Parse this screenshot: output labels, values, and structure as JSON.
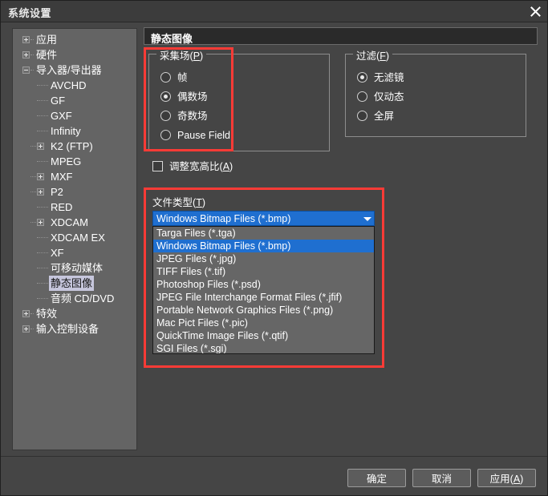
{
  "window": {
    "title": "系统设置",
    "close_icon": "close-icon"
  },
  "sidebar": {
    "items": [
      {
        "label": "应用",
        "depth": 0,
        "expander": "plus",
        "selected": false
      },
      {
        "label": "硬件",
        "depth": 0,
        "expander": "plus",
        "selected": false
      },
      {
        "label": "导入器/导出器",
        "depth": 0,
        "expander": "minus",
        "selected": false
      },
      {
        "label": "AVCHD",
        "depth": 1,
        "expander": "none",
        "selected": false
      },
      {
        "label": "GF",
        "depth": 1,
        "expander": "none",
        "selected": false
      },
      {
        "label": "GXF",
        "depth": 1,
        "expander": "none",
        "selected": false
      },
      {
        "label": "Infinity",
        "depth": 1,
        "expander": "none",
        "selected": false
      },
      {
        "label": "K2 (FTP)",
        "depth": 1,
        "expander": "plus",
        "selected": false
      },
      {
        "label": "MPEG",
        "depth": 1,
        "expander": "none",
        "selected": false
      },
      {
        "label": "MXF",
        "depth": 1,
        "expander": "plus",
        "selected": false
      },
      {
        "label": "P2",
        "depth": 1,
        "expander": "plus",
        "selected": false
      },
      {
        "label": "RED",
        "depth": 1,
        "expander": "none",
        "selected": false
      },
      {
        "label": "XDCAM",
        "depth": 1,
        "expander": "plus",
        "selected": false
      },
      {
        "label": "XDCAM EX",
        "depth": 1,
        "expander": "none",
        "selected": false
      },
      {
        "label": "XF",
        "depth": 1,
        "expander": "none",
        "selected": false
      },
      {
        "label": "可移动媒体",
        "depth": 1,
        "expander": "none",
        "selected": false
      },
      {
        "label": "静态图像",
        "depth": 1,
        "expander": "none",
        "selected": true
      },
      {
        "label": "音频 CD/DVD",
        "depth": 1,
        "expander": "none",
        "selected": false
      },
      {
        "label": "特效",
        "depth": 0,
        "expander": "plus",
        "selected": false
      },
      {
        "label": "输入控制设备",
        "depth": 0,
        "expander": "plus",
        "selected": false
      }
    ]
  },
  "content": {
    "header": "静态图像",
    "capture_field": {
      "title": "采集场",
      "accel": "P",
      "options": [
        {
          "label": "帧",
          "selected": false
        },
        {
          "label": "偶数场",
          "selected": true
        },
        {
          "label": "奇数场",
          "selected": false
        },
        {
          "label": "Pause Field",
          "selected": false
        }
      ]
    },
    "filter": {
      "title": "过滤",
      "accel": "F",
      "options": [
        {
          "label": "无滤镜",
          "selected": true
        },
        {
          "label": "仅动态",
          "selected": false
        },
        {
          "label": "全屏",
          "selected": false
        }
      ]
    },
    "aspect_checkbox": {
      "label": "调整宽高比",
      "accel": "A",
      "checked": false
    },
    "file_type": {
      "label": "文件类型",
      "accel": "T",
      "selected_value": "Windows Bitmap Files (*.bmp)",
      "dropdown_icon": "chevron-down-icon",
      "options": [
        {
          "label": "Targa Files (*.tga)",
          "selected": false
        },
        {
          "label": "Windows Bitmap Files (*.bmp)",
          "selected": true
        },
        {
          "label": "JPEG Files (*.jpg)",
          "selected": false
        },
        {
          "label": "TIFF Files (*.tif)",
          "selected": false
        },
        {
          "label": "Photoshop Files (*.psd)",
          "selected": false
        },
        {
          "label": "JPEG File Interchange Format Files (*.jfif)",
          "selected": false
        },
        {
          "label": "Portable Network Graphics Files (*.png)",
          "selected": false
        },
        {
          "label": "Mac Pict Files (*.pic)",
          "selected": false
        },
        {
          "label": "QuickTime Image Files (*.qtif)",
          "selected": false
        },
        {
          "label": "SGI Files (*.sgi)",
          "selected": false
        }
      ]
    }
  },
  "footer": {
    "ok": "确定",
    "cancel": "取消",
    "apply": "应用",
    "apply_accel": "A"
  },
  "annotations": {
    "highlight_color": "#fb3b36"
  }
}
